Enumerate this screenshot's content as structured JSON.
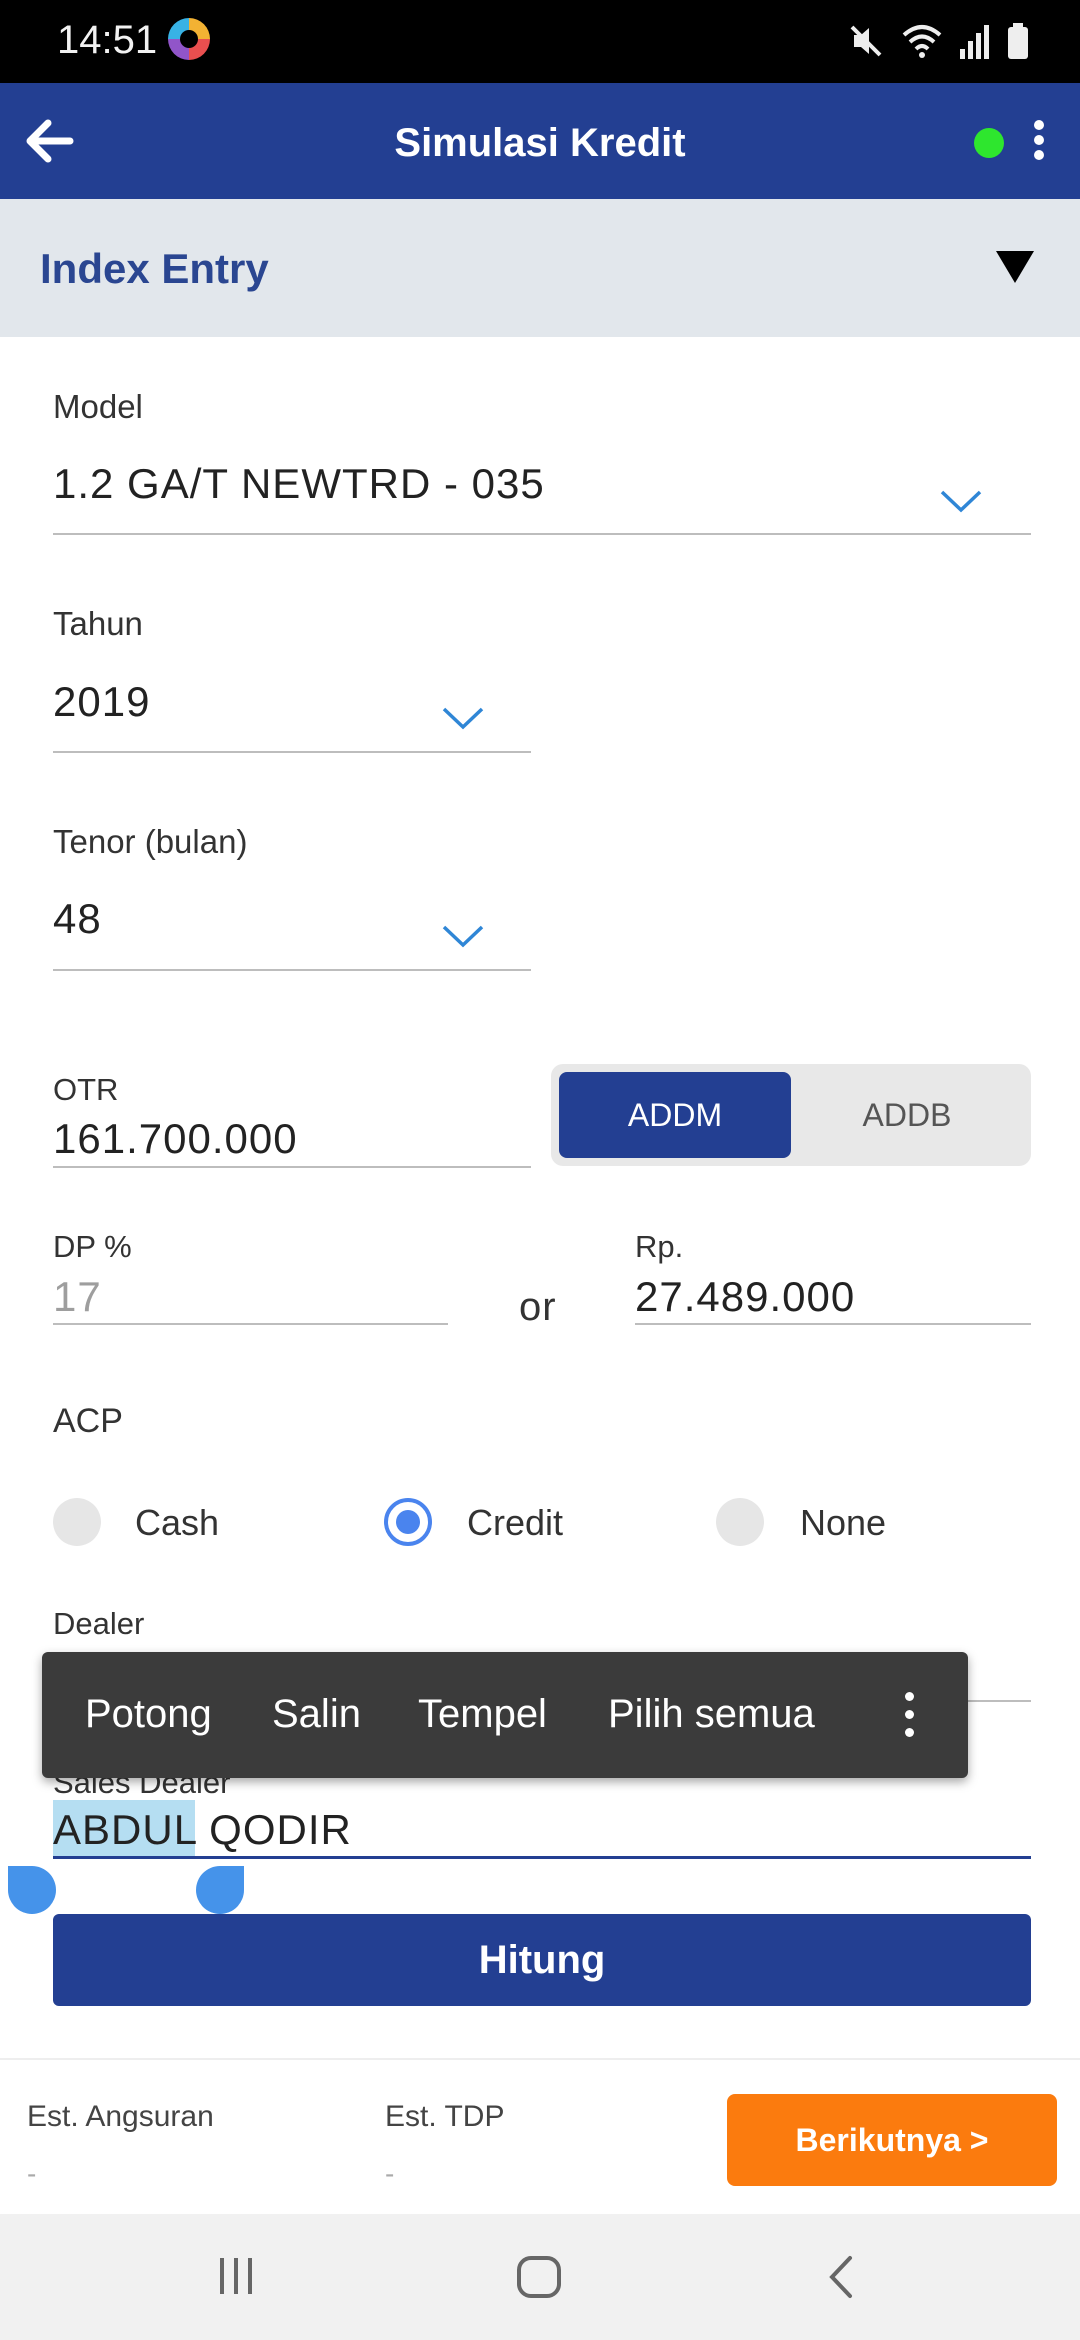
{
  "status_bar": {
    "time": "14:51"
  },
  "app_bar": {
    "title": "Simulasi Kredit"
  },
  "section": {
    "title": "Index Entry"
  },
  "form": {
    "model": {
      "label": "Model",
      "value": "1.2 GA/T NEWTRD - 035"
    },
    "tahun": {
      "label": "Tahun",
      "value": "2019"
    },
    "tenor": {
      "label": "Tenor (bulan)",
      "value": "48"
    },
    "otr": {
      "label": "OTR",
      "value": "161.700.000"
    },
    "toggle": {
      "options": [
        "ADDM",
        "ADDB"
      ],
      "selected": "ADDM"
    },
    "dp_percent": {
      "label": "DP %",
      "placeholder": "17"
    },
    "or_text": "or",
    "rp": {
      "label": "Rp.",
      "value": "27.489.000"
    },
    "acp": {
      "label": "ACP",
      "options": [
        "Cash",
        "Credit",
        "None"
      ],
      "selected": "Credit"
    },
    "dealer": {
      "label": "Dealer"
    },
    "sales_dealer": {
      "label": "Sales Dealer",
      "value_selected": "ABDUL",
      "value_rest": " QODIR"
    },
    "submit_label": "Hitung"
  },
  "context_menu": {
    "items": [
      "Potong",
      "Salin",
      "Tempel",
      "Pilih semua"
    ]
  },
  "bottom_bar": {
    "est_angsuran": {
      "label": "Est. Angsuran",
      "value": "-"
    },
    "est_tdp": {
      "label": "Est. TDP",
      "value": "-"
    },
    "next_label": "Berikutnya >"
  },
  "colors": {
    "primary": "#233f92",
    "accent": "#fb7b0e",
    "online": "#2ee62e",
    "radio": "#4a84ee"
  }
}
